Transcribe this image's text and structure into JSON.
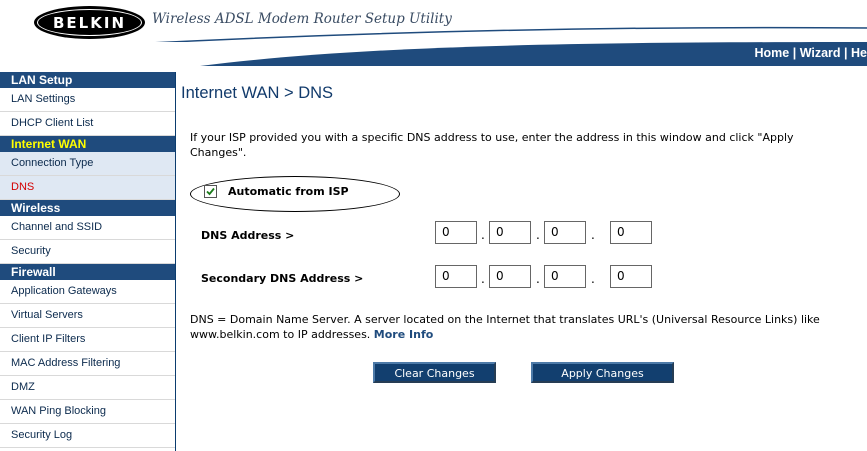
{
  "header": {
    "brand": "BELKIN",
    "subtitle": "Wireless ADSL Modem Router Setup Utility",
    "nav": {
      "home": "Home",
      "sep1": " | ",
      "wizard": "Wizard",
      "sep2": " | ",
      "help": "He"
    }
  },
  "sidebar": {
    "sections": [
      {
        "heading": "LAN Setup",
        "items": [
          "LAN Settings",
          "DHCP Client List"
        ]
      },
      {
        "heading": "Internet WAN",
        "items": [
          "Connection Type",
          "DNS"
        ]
      },
      {
        "heading": "Wireless",
        "items": [
          "Channel and SSID",
          "Security"
        ]
      },
      {
        "heading": "Firewall",
        "items": [
          "Application Gateways",
          "Virtual Servers",
          "Client IP Filters",
          "MAC Address Filtering",
          "DMZ",
          "WAN Ping Blocking",
          "Security Log"
        ]
      }
    ]
  },
  "main": {
    "title": "Internet WAN > DNS",
    "intro": "If your ISP provided you with a specific DNS address to use, enter the address in this window and click \"Apply Changes\".",
    "auto_label": "Automatic from ISP",
    "auto_checked": true,
    "dns_label": "DNS Address >",
    "dns_values": [
      "0",
      "0",
      "0",
      "0"
    ],
    "secondary_label": "Secondary DNS Address >",
    "secondary_values": [
      "0",
      "0",
      "0",
      "0"
    ],
    "note": "DNS = Domain Name Server. A server located on the Internet that translates URL's (Universal Resource Links) like www.belkin.com to IP addresses.",
    "more_info": "More Info",
    "clear_button": "Clear Changes",
    "apply_button": "Apply Changes"
  },
  "colors": {
    "navy": "#1f4b7d",
    "active_heading": "#ffff00",
    "selected_item": "#d40000"
  }
}
